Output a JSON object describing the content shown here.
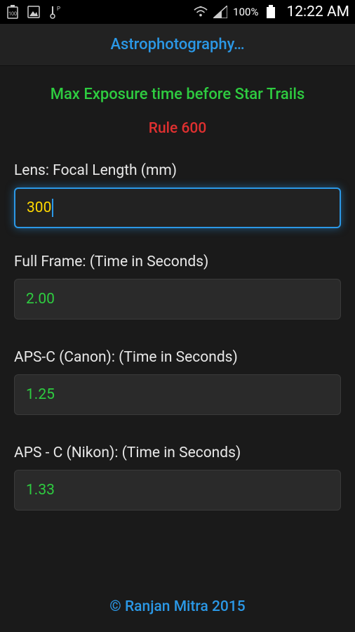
{
  "status": {
    "percent": "100%",
    "time": "12:22 AM"
  },
  "header": {
    "title": "Astrophotography…"
  },
  "headings": {
    "main": "Max Exposure time before Star Trails",
    "rule": "Rule 600"
  },
  "fields": {
    "focal": {
      "label": "Lens: Focal Length (mm)",
      "value": "300"
    },
    "full": {
      "label": "Full Frame: (Time in Seconds)",
      "value": "2.00"
    },
    "canon": {
      "label": "APS-C (Canon): (Time in Seconds)",
      "value": "1.25"
    },
    "nikon": {
      "label": "APS - C (Nikon): (Time in Seconds)",
      "value": "1.33"
    }
  },
  "footer": "© Ranjan Mitra 2015"
}
